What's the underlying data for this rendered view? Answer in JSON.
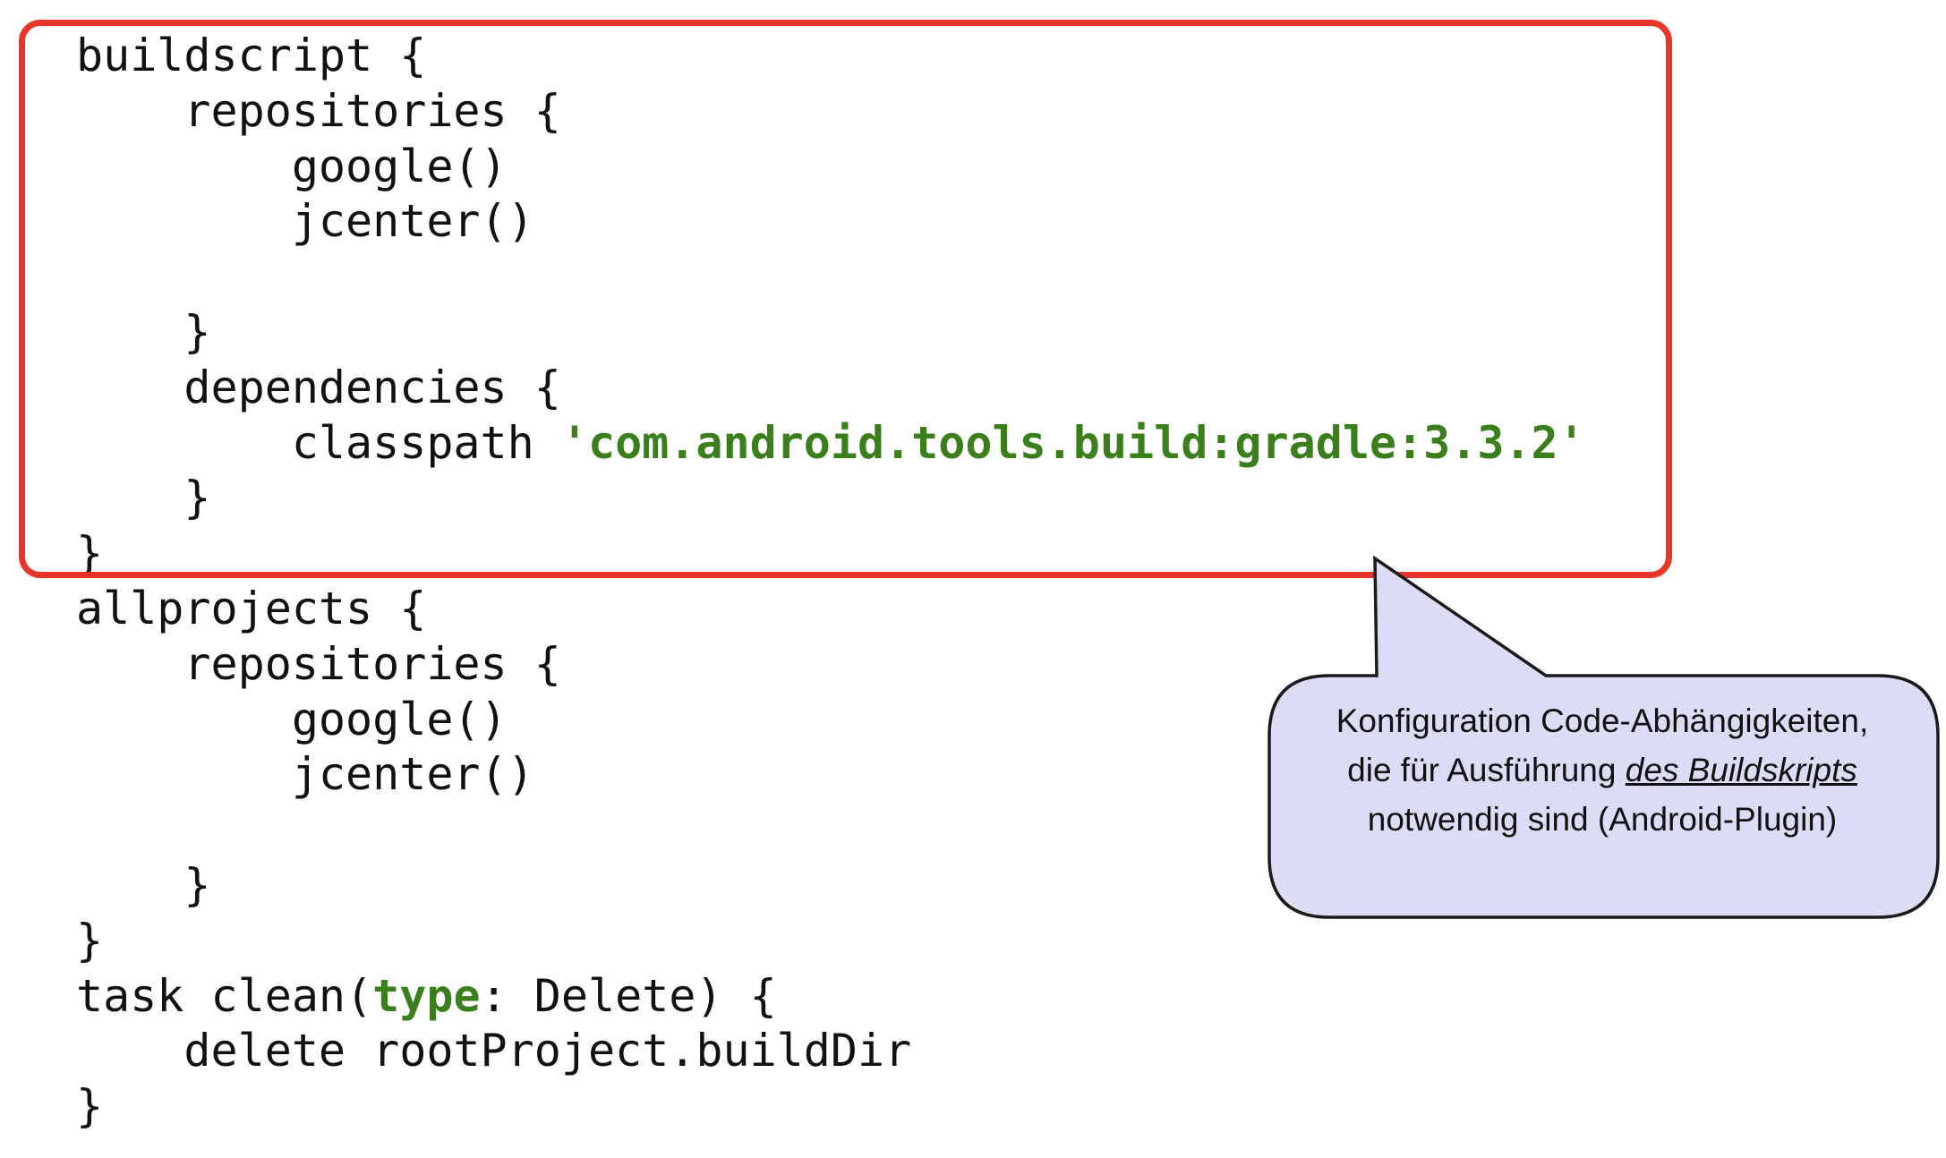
{
  "code": {
    "l1": "buildscript {",
    "l2": "    repositories {",
    "l3": "        google()",
    "l4": "        jcenter()",
    "l5": "",
    "l6": "    }",
    "l7": "    dependencies {",
    "l8_pre": "        classpath ",
    "l8_str": "'com.android.tools.build:gradle:3.3.2'",
    "l9": "    }",
    "l10": "}",
    "l11": "allprojects {",
    "l12": "    repositories {",
    "l13": "        google()",
    "l14": "        jcenter()",
    "l15": "",
    "l16": "    }",
    "l17": "}",
    "l18_pre": "task clean(",
    "l18_kw": "type",
    "l18_post": ": Delete) {",
    "l19": "    delete rootProject.buildDir",
    "l20": "}"
  },
  "callout": {
    "line1": "Konfiguration Code-Abhängigkeiten,",
    "line2_pre": "die für Ausführung ",
    "line2_em": "des Buildskripts",
    "line3": "notwendig sind (Android-Plugin)"
  },
  "colors": {
    "highlight_border": "#e8352a",
    "callout_fill": "#dcdcf7",
    "string_literal": "#3b7f1c"
  }
}
